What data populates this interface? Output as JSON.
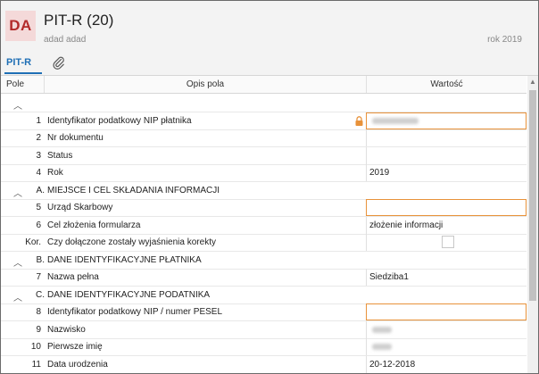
{
  "header": {
    "avatar": "DA",
    "title": "PIT-R (20)",
    "subtitle": "adad adad",
    "year": "rok 2019"
  },
  "tabs": {
    "pitr": "PIT-R",
    "attachments_icon": "paperclip-icon"
  },
  "columns": {
    "pole": "Pole",
    "opis": "Opis pola",
    "wartosc": "Wartość"
  },
  "rows": [
    {
      "kind": "section",
      "code": "",
      "text": ""
    },
    {
      "kind": "field",
      "num": "1",
      "desc": "Identyfikator podatkowy NIP płatnika",
      "value": "",
      "input": true,
      "blurred": true,
      "lock": true
    },
    {
      "kind": "field",
      "num": "2",
      "desc": "Nr dokumentu",
      "value": ""
    },
    {
      "kind": "field",
      "num": "3",
      "desc": "Status",
      "value": ""
    },
    {
      "kind": "field",
      "num": "4",
      "desc": "Rok",
      "value": "2019"
    },
    {
      "kind": "section",
      "code": "A.",
      "text": "MIEJSCE I CEL SKŁADANIA INFORMACJI"
    },
    {
      "kind": "field",
      "num": "5",
      "desc": "Urząd Skarbowy",
      "value": "",
      "input": true
    },
    {
      "kind": "field",
      "num": "6",
      "desc": "Cel złożenia formularza",
      "value": "złożenie informacji"
    },
    {
      "kind": "field",
      "num": "Kor.",
      "desc": "Czy dołączone zostały wyjaśnienia korekty",
      "value": "",
      "checkbox": true
    },
    {
      "kind": "section",
      "code": "B.",
      "text": "DANE IDENTYFIKACYJNE PŁATNIKA"
    },
    {
      "kind": "field",
      "num": "7",
      "desc": "Nazwa pełna",
      "value": "Siedziba1"
    },
    {
      "kind": "section",
      "code": "C.",
      "text": "DANE IDENTYFIKACYJNE PODATNIKA"
    },
    {
      "kind": "field",
      "num": "8",
      "desc": "Identyfikator podatkowy NIP / numer PESEL",
      "value": "",
      "input": true
    },
    {
      "kind": "field",
      "num": "9",
      "desc": "Nazwisko",
      "value": "",
      "blurred": true,
      "short": true
    },
    {
      "kind": "field",
      "num": "10",
      "desc": "Pierwsze imię",
      "value": "",
      "blurred": true,
      "short": true
    },
    {
      "kind": "field",
      "num": "11",
      "desc": "Data urodzenia",
      "value": "20-12-2018"
    }
  ]
}
